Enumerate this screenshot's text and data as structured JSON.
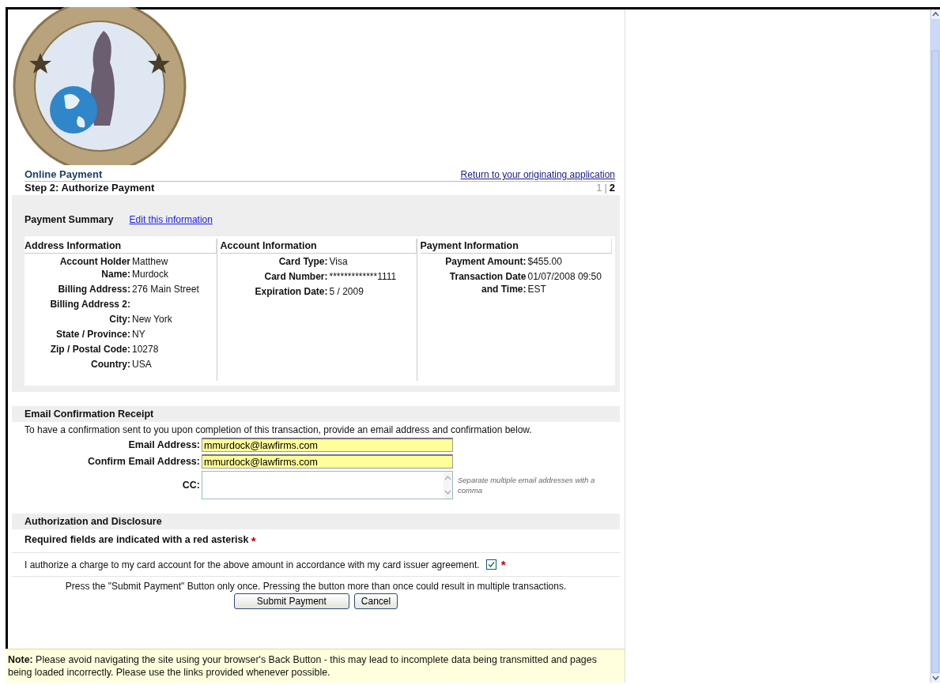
{
  "header": {
    "title": "Online Payment",
    "return_link": "Return to your originating application",
    "step_title": "Step 2: Authorize Payment",
    "step_separator": "|",
    "steps": [
      {
        "label": "1",
        "selected": false
      },
      {
        "label": "2",
        "selected": true
      }
    ]
  },
  "summary": {
    "title": "Payment Summary",
    "edit_link": "Edit this information"
  },
  "info_columns": [
    {
      "heading": "Address Information",
      "fields": [
        {
          "label": "Account Holder Name:",
          "value": "Matthew Murdock"
        },
        {
          "label": "Billing Address:",
          "value": "276 Main Street"
        },
        {
          "label": "Billing Address 2:"
        },
        {
          "label": "City:",
          "value": "New York"
        },
        {
          "label": "State / Province:",
          "value": "NY"
        },
        {
          "label": "Zip / Postal Code:",
          "value": "10278"
        },
        {
          "label": "Country:",
          "value": "USA"
        }
      ]
    },
    {
      "heading": "Account Information",
      "fields": [
        {
          "label": "Card Type:",
          "value": "Visa"
        },
        {
          "label": "Card Number:",
          "value": "*************1111"
        },
        {
          "label": "Expiration Date:",
          "value": "5 / 2009"
        }
      ]
    },
    {
      "heading": "Payment Information",
      "fields": [
        {
          "label": "Payment Amount:",
          "value": "$455.00"
        },
        {
          "label": "Transaction Date and Time:",
          "value": "01/07/2008 09:50 EST"
        }
      ]
    }
  ],
  "email": {
    "heading": "Email Confirmation Receipt",
    "description": "To have a confirmation sent to you upon completion of this transaction, provide an email address and confirmation below.",
    "fields": [
      {
        "kind": "input",
        "label": "Email Address:",
        "value": "mmurdock@lawfirms.com"
      },
      {
        "kind": "input",
        "label": "Confirm Email Address:",
        "value": "mmurdock@lawfirms.com"
      },
      {
        "kind": "textarea",
        "label": "CC:",
        "hint": "Separate multiple email addresses with a comma"
      }
    ]
  },
  "authorization": {
    "heading": "Authorization and Disclosure",
    "required_note": "Required fields are indicated with a red asterisk",
    "required_mark": "*",
    "agreement": {
      "text": "I authorize a charge to my card account for the above amount in accordance with my card issuer agreement.",
      "checked": true,
      "required_mark": "*"
    },
    "warning": "Press the \"Submit Payment\" Button only once. Pressing the button more than once could result in multiple transactions.",
    "buttons": [
      "Submit Payment",
      "Cancel"
    ]
  },
  "note": "**Note:** Please avoid navigating the site using your browser's Back Button - this may lead to incomplete data being transmitted and pages being loaded incorrectly. Please use the links provided whenever possible."
}
